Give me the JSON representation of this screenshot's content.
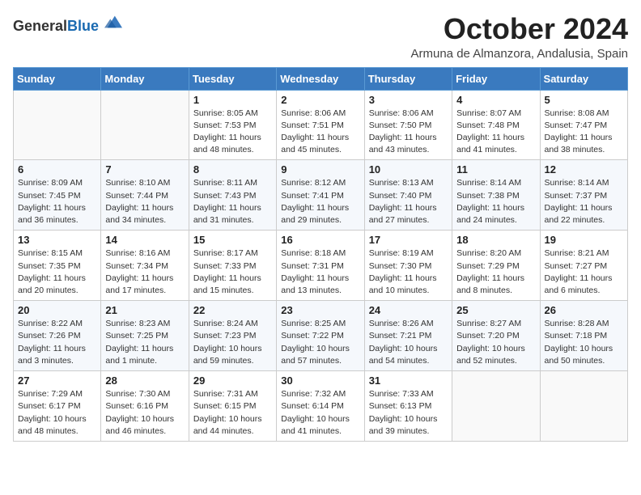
{
  "logo": {
    "general": "General",
    "blue": "Blue"
  },
  "title": "October 2024",
  "subtitle": "Armuna de Almanzora, Andalusia, Spain",
  "days_of_week": [
    "Sunday",
    "Monday",
    "Tuesday",
    "Wednesday",
    "Thursday",
    "Friday",
    "Saturday"
  ],
  "weeks": [
    [
      {
        "day": "",
        "info": ""
      },
      {
        "day": "",
        "info": ""
      },
      {
        "day": "1",
        "info": "Sunrise: 8:05 AM\nSunset: 7:53 PM\nDaylight: 11 hours and 48 minutes."
      },
      {
        "day": "2",
        "info": "Sunrise: 8:06 AM\nSunset: 7:51 PM\nDaylight: 11 hours and 45 minutes."
      },
      {
        "day": "3",
        "info": "Sunrise: 8:06 AM\nSunset: 7:50 PM\nDaylight: 11 hours and 43 minutes."
      },
      {
        "day": "4",
        "info": "Sunrise: 8:07 AM\nSunset: 7:48 PM\nDaylight: 11 hours and 41 minutes."
      },
      {
        "day": "5",
        "info": "Sunrise: 8:08 AM\nSunset: 7:47 PM\nDaylight: 11 hours and 38 minutes."
      }
    ],
    [
      {
        "day": "6",
        "info": "Sunrise: 8:09 AM\nSunset: 7:45 PM\nDaylight: 11 hours and 36 minutes."
      },
      {
        "day": "7",
        "info": "Sunrise: 8:10 AM\nSunset: 7:44 PM\nDaylight: 11 hours and 34 minutes."
      },
      {
        "day": "8",
        "info": "Sunrise: 8:11 AM\nSunset: 7:43 PM\nDaylight: 11 hours and 31 minutes."
      },
      {
        "day": "9",
        "info": "Sunrise: 8:12 AM\nSunset: 7:41 PM\nDaylight: 11 hours and 29 minutes."
      },
      {
        "day": "10",
        "info": "Sunrise: 8:13 AM\nSunset: 7:40 PM\nDaylight: 11 hours and 27 minutes."
      },
      {
        "day": "11",
        "info": "Sunrise: 8:14 AM\nSunset: 7:38 PM\nDaylight: 11 hours and 24 minutes."
      },
      {
        "day": "12",
        "info": "Sunrise: 8:14 AM\nSunset: 7:37 PM\nDaylight: 11 hours and 22 minutes."
      }
    ],
    [
      {
        "day": "13",
        "info": "Sunrise: 8:15 AM\nSunset: 7:35 PM\nDaylight: 11 hours and 20 minutes."
      },
      {
        "day": "14",
        "info": "Sunrise: 8:16 AM\nSunset: 7:34 PM\nDaylight: 11 hours and 17 minutes."
      },
      {
        "day": "15",
        "info": "Sunrise: 8:17 AM\nSunset: 7:33 PM\nDaylight: 11 hours and 15 minutes."
      },
      {
        "day": "16",
        "info": "Sunrise: 8:18 AM\nSunset: 7:31 PM\nDaylight: 11 hours and 13 minutes."
      },
      {
        "day": "17",
        "info": "Sunrise: 8:19 AM\nSunset: 7:30 PM\nDaylight: 11 hours and 10 minutes."
      },
      {
        "day": "18",
        "info": "Sunrise: 8:20 AM\nSunset: 7:29 PM\nDaylight: 11 hours and 8 minutes."
      },
      {
        "day": "19",
        "info": "Sunrise: 8:21 AM\nSunset: 7:27 PM\nDaylight: 11 hours and 6 minutes."
      }
    ],
    [
      {
        "day": "20",
        "info": "Sunrise: 8:22 AM\nSunset: 7:26 PM\nDaylight: 11 hours and 3 minutes."
      },
      {
        "day": "21",
        "info": "Sunrise: 8:23 AM\nSunset: 7:25 PM\nDaylight: 11 hours and 1 minute."
      },
      {
        "day": "22",
        "info": "Sunrise: 8:24 AM\nSunset: 7:23 PM\nDaylight: 10 hours and 59 minutes."
      },
      {
        "day": "23",
        "info": "Sunrise: 8:25 AM\nSunset: 7:22 PM\nDaylight: 10 hours and 57 minutes."
      },
      {
        "day": "24",
        "info": "Sunrise: 8:26 AM\nSunset: 7:21 PM\nDaylight: 10 hours and 54 minutes."
      },
      {
        "day": "25",
        "info": "Sunrise: 8:27 AM\nSunset: 7:20 PM\nDaylight: 10 hours and 52 minutes."
      },
      {
        "day": "26",
        "info": "Sunrise: 8:28 AM\nSunset: 7:18 PM\nDaylight: 10 hours and 50 minutes."
      }
    ],
    [
      {
        "day": "27",
        "info": "Sunrise: 7:29 AM\nSunset: 6:17 PM\nDaylight: 10 hours and 48 minutes."
      },
      {
        "day": "28",
        "info": "Sunrise: 7:30 AM\nSunset: 6:16 PM\nDaylight: 10 hours and 46 minutes."
      },
      {
        "day": "29",
        "info": "Sunrise: 7:31 AM\nSunset: 6:15 PM\nDaylight: 10 hours and 44 minutes."
      },
      {
        "day": "30",
        "info": "Sunrise: 7:32 AM\nSunset: 6:14 PM\nDaylight: 10 hours and 41 minutes."
      },
      {
        "day": "31",
        "info": "Sunrise: 7:33 AM\nSunset: 6:13 PM\nDaylight: 10 hours and 39 minutes."
      },
      {
        "day": "",
        "info": ""
      },
      {
        "day": "",
        "info": ""
      }
    ]
  ]
}
